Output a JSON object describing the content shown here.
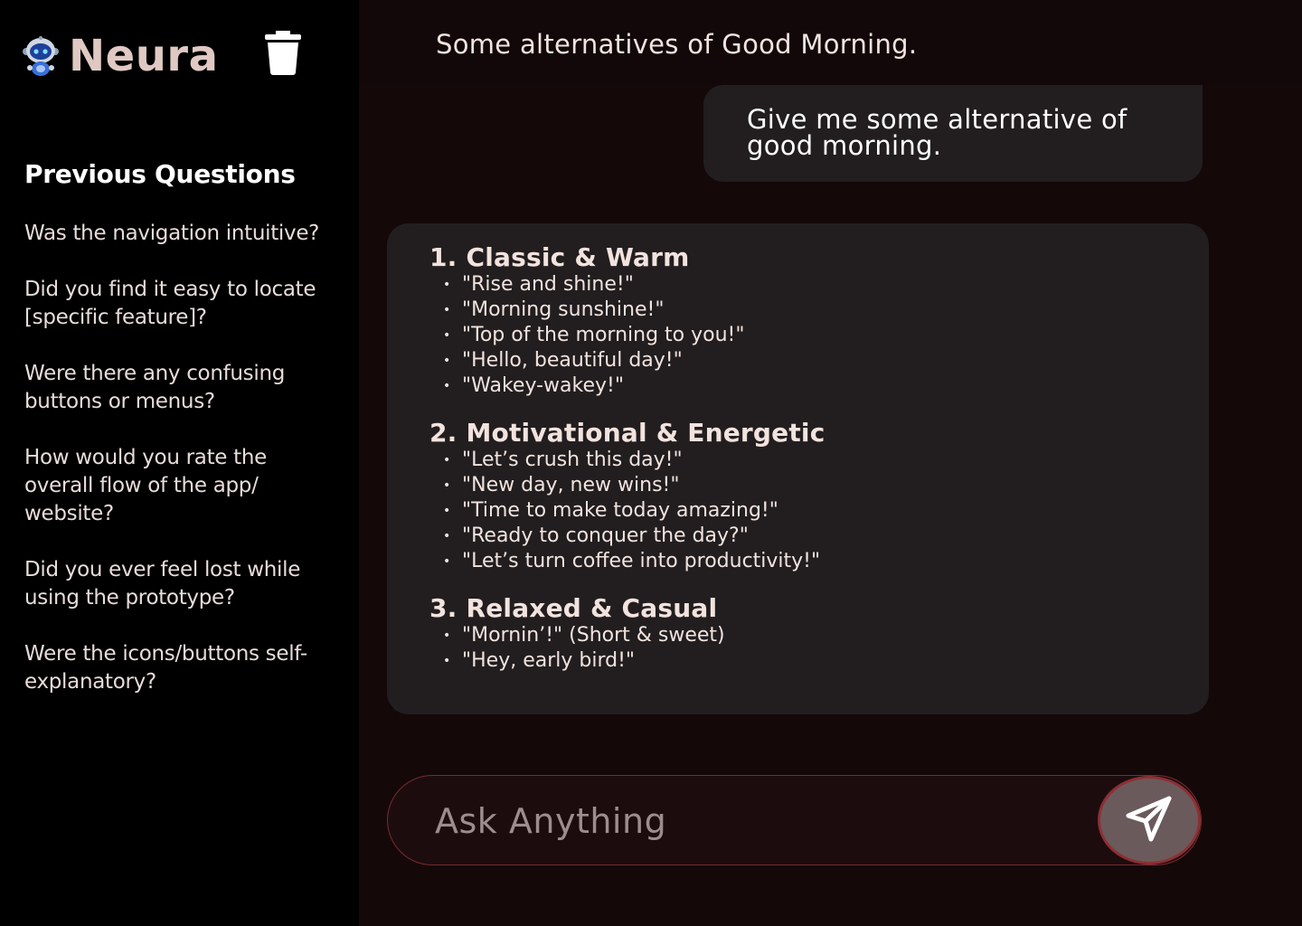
{
  "app": {
    "name": "Neura"
  },
  "sidebar": {
    "heading": "Previous Questions",
    "items": [
      {
        "label": "Was the navigation intuitive?"
      },
      {
        "label": "Did you find it easy to locate [specific feature]?"
      },
      {
        "label": "Were there any confusing buttons or menus?"
      },
      {
        "label": "How would you rate the overall flow of the app/ website?"
      },
      {
        "label": "Did you ever feel lost while using the prototype?"
      },
      {
        "label": "Were the icons/buttons self-explanatory?"
      }
    ],
    "icons": {
      "logo": "robot-icon",
      "clear": "trash-icon"
    }
  },
  "chat": {
    "title": "Some alternatives of Good Morning.",
    "user_message": "Give me some alternative of good morning.",
    "response": {
      "sections": [
        {
          "title": "1. Classic & Warm",
          "items": [
            "\"Rise and shine!\"",
            "\"Morning sunshine!\"",
            "\"Top of the morning to you!\"",
            "\"Hello, beautiful day!\"",
            "\"Wakey-wakey!\""
          ]
        },
        {
          "title": "2. Motivational & Energetic",
          "items": [
            "\"Let’s crush this day!\"",
            "\"New day, new wins!\"",
            "\"Time to make today amazing!\"",
            "\"Ready to conquer the day?\"",
            "\"Let’s turn coffee into productivity!\""
          ]
        },
        {
          "title": "3. Relaxed & Casual",
          "items": [
            "\"Mornin’!\" (Short & sweet)",
            "\"Hey, early bird!\""
          ]
        }
      ]
    }
  },
  "input": {
    "placeholder": "Ask Anything",
    "value": "",
    "send_icon": "send-icon"
  },
  "colors": {
    "sidebar_bg": "#000000",
    "main_bg": "#140809",
    "card_bg": "#221e1f",
    "accent_border": "#8d2f35",
    "send_button_bg": "#6b5a5b"
  }
}
